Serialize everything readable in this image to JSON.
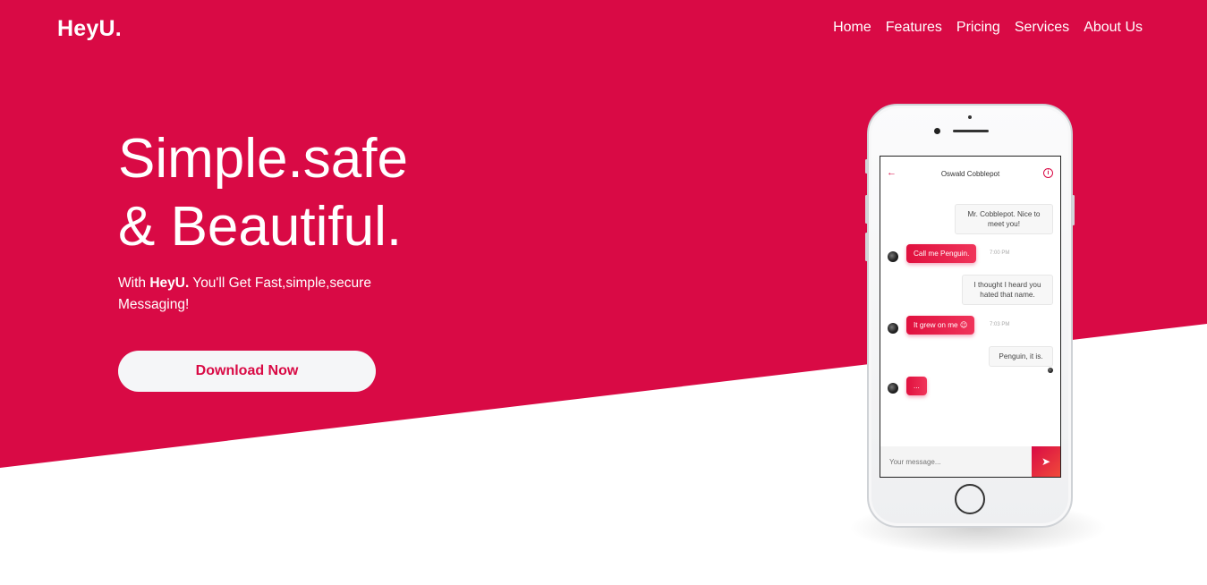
{
  "brand": {
    "name": "HeyU."
  },
  "nav": {
    "items": [
      {
        "label": "Home"
      },
      {
        "label": "Features"
      },
      {
        "label": "Pricing"
      },
      {
        "label": "Services"
      },
      {
        "label": "About Us"
      }
    ]
  },
  "hero": {
    "headline_line1": "Simple.safe",
    "headline_line2": "& Beautiful.",
    "subtitle_prefix": "With ",
    "subtitle_brand": "HeyU.",
    "subtitle_suffix": " You'll Get Fast,simple,secure Messaging!",
    "cta_label": "Download Now"
  },
  "phone_chat": {
    "contact_name": "Oswald Cobblepot",
    "messages": [
      {
        "from": "them",
        "text": "Mr. Cobblepot. Nice to meet you!"
      },
      {
        "from": "me",
        "text": "Call me Penguin.",
        "time": "7:00 PM"
      },
      {
        "from": "them",
        "text": "I thought I heard you hated that name."
      },
      {
        "from": "me",
        "text": "It grew on me 😉",
        "time": "7:03 PM"
      },
      {
        "from": "them",
        "text": "Penguin, it is."
      },
      {
        "from": "me",
        "text": "..."
      }
    ],
    "composer_placeholder": "Your message..."
  },
  "colors": {
    "brand_primary": "#d90a45",
    "button_bg": "#f5f6f8"
  }
}
